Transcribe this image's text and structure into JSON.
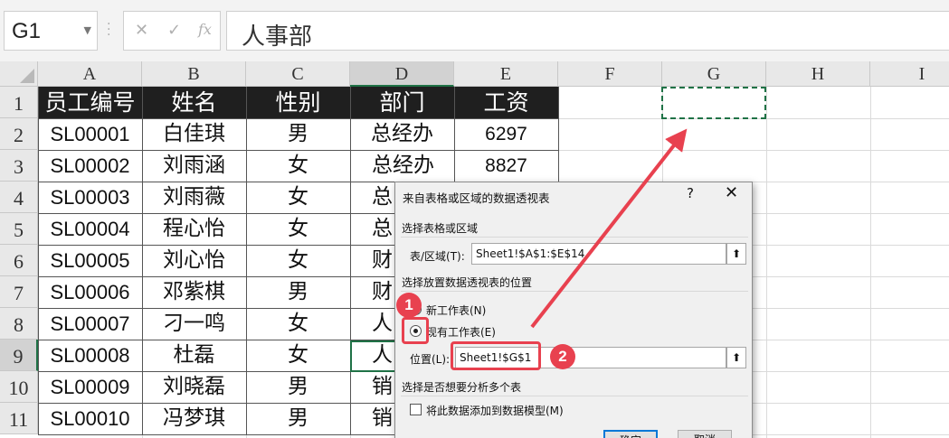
{
  "formula_bar": {
    "name_box": "G1",
    "cancel_icon": "✕",
    "enter_icon": "✓",
    "fx_icon": "fx",
    "content": "人事部"
  },
  "columns": [
    "A",
    "B",
    "C",
    "D",
    "E",
    "F",
    "G",
    "H",
    "I"
  ],
  "rows": [
    "1",
    "2",
    "3",
    "4",
    "5",
    "6",
    "7",
    "8",
    "9",
    "10",
    "11"
  ],
  "table": {
    "headers": [
      "员工编号",
      "姓名",
      "性别",
      "部门",
      "工资"
    ],
    "rows": [
      [
        "SL00001",
        "白佳琪",
        "男",
        "总经办",
        "6297"
      ],
      [
        "SL00002",
        "刘雨涵",
        "女",
        "总经办",
        "8827"
      ],
      [
        "SL00003",
        "刘雨薇",
        "女",
        "总",
        ""
      ],
      [
        "SL00004",
        "程心怡",
        "女",
        "总",
        ""
      ],
      [
        "SL00005",
        "刘心怡",
        "女",
        "财",
        ""
      ],
      [
        "SL00006",
        "邓紫棋",
        "男",
        "财",
        ""
      ],
      [
        "SL00007",
        "刁一鸣",
        "女",
        "人",
        ""
      ],
      [
        "SL00008",
        "杜磊",
        "女",
        "人",
        ""
      ],
      [
        "SL00009",
        "刘晓磊",
        "男",
        "销",
        ""
      ],
      [
        "SL00010",
        "冯梦琪",
        "男",
        "销",
        ""
      ]
    ]
  },
  "dialog": {
    "title": "来自表格或区域的数据透视表",
    "help": "?",
    "close": "✕",
    "section1": "选择表格或区域",
    "range_label": "表/区域(T):",
    "range_value": "Sheet1!$A$1:$E$14",
    "section2": "选择放置数据透视表的位置",
    "option_new": "新工作表(N)",
    "option_existing": "现有工作表(E)",
    "location_label": "位置(L):",
    "location_value": "Sheet1!$G$1",
    "section3": "选择是否想要分析多个表",
    "datamodel_label": "将此数据添加到数据模型(M)",
    "ok": "确定",
    "cancel": "取消"
  },
  "annotations": {
    "badge1": "1",
    "badge2": "2"
  },
  "colors": {
    "accent_green": "#1f7246",
    "annotation_red": "#e8414f",
    "header_fill": "#1f1f1f"
  }
}
